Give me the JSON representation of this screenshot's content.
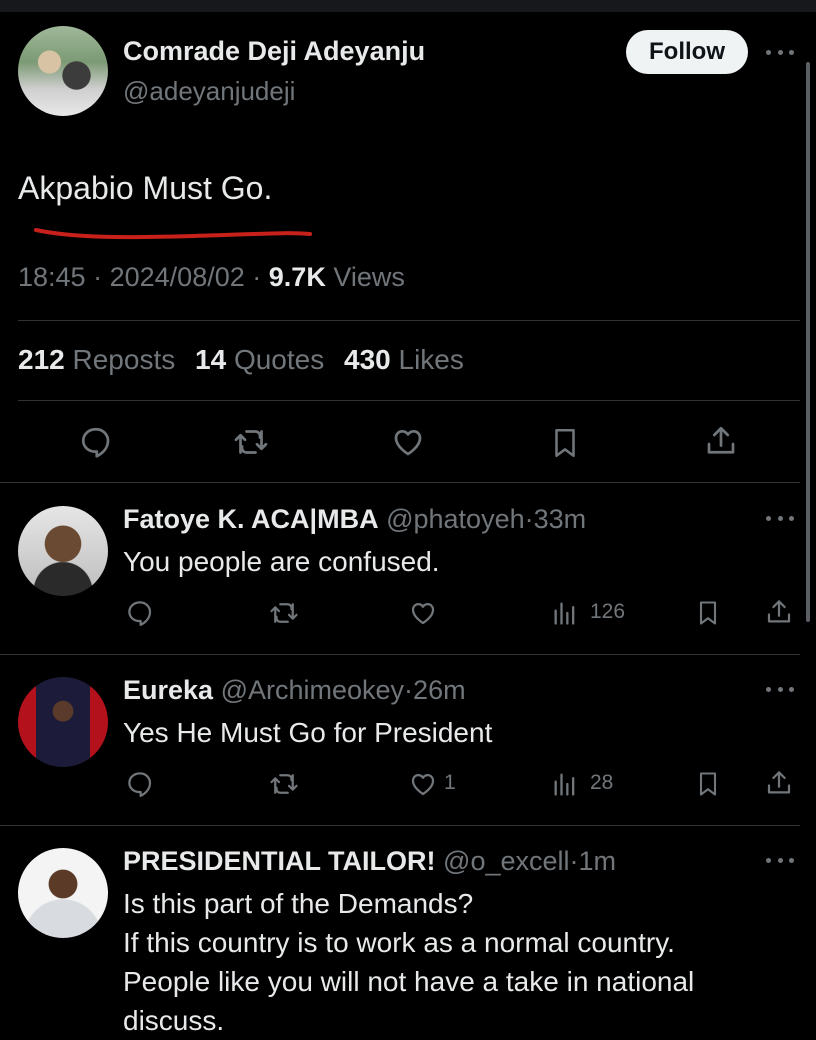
{
  "main_tweet": {
    "author_name": "Comrade Deji Adeyanju",
    "author_handle": "@adeyanjudeji",
    "follow_label": "Follow",
    "text": "Akpabio Must Go.",
    "underline_color": "#c8201b",
    "time": "18:45",
    "date": "2024/08/02",
    "views_count": "9.7K",
    "views_label": "Views",
    "reposts_count": "212",
    "reposts_label": "Reposts",
    "quotes_count": "14",
    "quotes_label": "Quotes",
    "likes_count": "430",
    "likes_label": "Likes",
    "action_icons": [
      "reply-icon",
      "repost-icon",
      "like-icon",
      "bookmark-icon",
      "share-icon"
    ]
  },
  "replies": [
    {
      "name": "Fatoye K. ACA|MBA",
      "handle": "@phatoyeh",
      "time": "33m",
      "text": [
        "You people are confused."
      ],
      "likes": "",
      "views": "126"
    },
    {
      "name": "Eureka",
      "handle": "@Archimeokey",
      "time": "26m",
      "text": [
        "Yes He Must Go for President"
      ],
      "likes": "1",
      "views": "28"
    },
    {
      "name": "PRESIDENTIAL TAILOR!",
      "handle": "@o_excell",
      "time": "1m",
      "text": [
        "Is this part of the Demands?",
        "If this country is to work as a normal country.",
        "People like you will not have a take in national",
        "discuss."
      ]
    }
  ],
  "separator": "·",
  "colors": {
    "background": "#000000",
    "text": "#e7e9ea",
    "muted": "#71767b",
    "divider": "#2f3336"
  }
}
